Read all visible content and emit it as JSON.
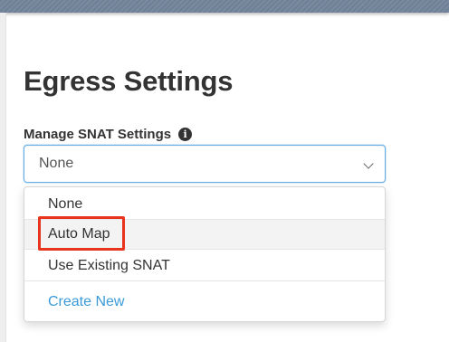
{
  "page": {
    "title": "Egress Settings"
  },
  "snat": {
    "label": "Manage SNAT Settings",
    "info_icon": "info-icon",
    "selected_value": "None",
    "options": [
      "None",
      "Auto Map",
      "Use Existing SNAT"
    ],
    "create_link": "Create New",
    "highlighted_option": "Auto Map"
  },
  "colors": {
    "link": "#3a9bd8",
    "focus_border": "#66afe9",
    "highlight": "#e8341c",
    "banner": "#6f7f94"
  }
}
